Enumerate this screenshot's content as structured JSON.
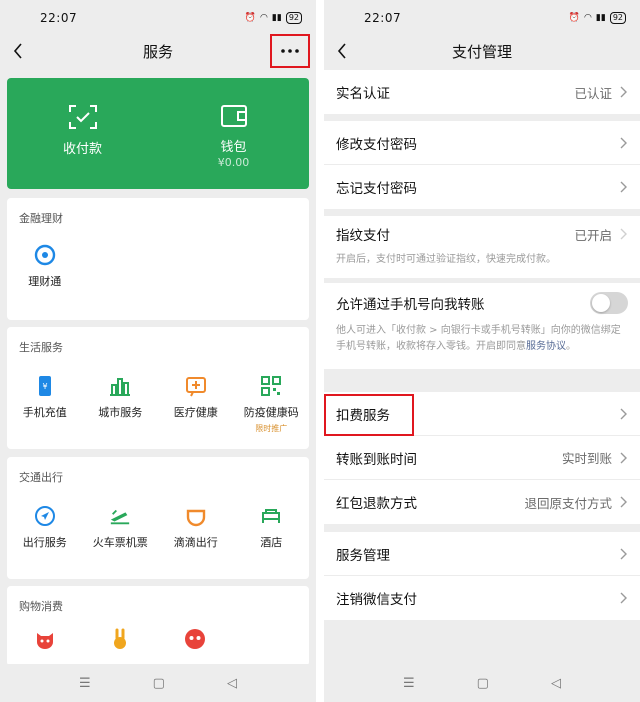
{
  "left": {
    "status": {
      "time": "22:07",
      "battery": "92"
    },
    "title": "服务",
    "wallet_card": {
      "pay": "收付款",
      "wallet": "钱包",
      "wallet_balance": "¥0.00"
    },
    "finance": {
      "title": "金融理财",
      "items": [
        {
          "label": "理财通",
          "icon": "licaitong-icon"
        }
      ]
    },
    "life": {
      "title": "生活服务",
      "items": [
        {
          "label": "手机充值",
          "icon": "phone-recharge-icon"
        },
        {
          "label": "城市服务",
          "icon": "city-icon"
        },
        {
          "label": "医疗健康",
          "icon": "medical-icon"
        },
        {
          "label": "防疫健康码",
          "icon": "qr-code-icon",
          "tag": "限时推广"
        }
      ]
    },
    "transport": {
      "title": "交通出行",
      "items": [
        {
          "label": "出行服务",
          "icon": "navigation-icon"
        },
        {
          "label": "火车票机票",
          "icon": "train-icon"
        },
        {
          "label": "滴滴出行",
          "icon": "didi-icon"
        },
        {
          "label": "酒店",
          "icon": "hotel-icon"
        }
      ]
    },
    "shopping": {
      "title": "购物消费",
      "items": [
        {
          "icon": "cat-mall-icon"
        },
        {
          "icon": "rabbit-icon"
        },
        {
          "icon": "panda-icon"
        }
      ]
    }
  },
  "right": {
    "status": {
      "time": "22:07",
      "battery": "92"
    },
    "title": "支付管理",
    "rows": {
      "realname": {
        "label": "实名认证",
        "value": "已认证"
      },
      "change_pwd": {
        "label": "修改支付密码"
      },
      "forgot_pwd": {
        "label": "忘记支付密码"
      },
      "fingerprint": {
        "label": "指纹支付",
        "value": "已开启",
        "desc": "开启后，支付时可通过验证指纹，快速完成付款。"
      },
      "phone_transfer": {
        "label": "允许通过手机号向我转账",
        "desc": "他人可进入「收付款 > 向银行卡或手机号转账」向你的微信绑定手机号转账，收款将存入零钱。开启即同意",
        "desc_link": "服务协议",
        "desc_end": "。",
        "enabled": false
      },
      "deduction": {
        "label": "扣费服务"
      },
      "transfer_time": {
        "label": "转账到账时间",
        "value": "实时到账"
      },
      "refund": {
        "label": "红包退款方式",
        "value": "退回原支付方式"
      },
      "service_mgmt": {
        "label": "服务管理"
      },
      "cancel_pay": {
        "label": "注销微信支付"
      }
    }
  },
  "colors": {
    "wechat_green": "#29a85a",
    "highlight_red": "#e0171f",
    "link_blue": "#576b95",
    "tag_orange": "#d9912f"
  }
}
